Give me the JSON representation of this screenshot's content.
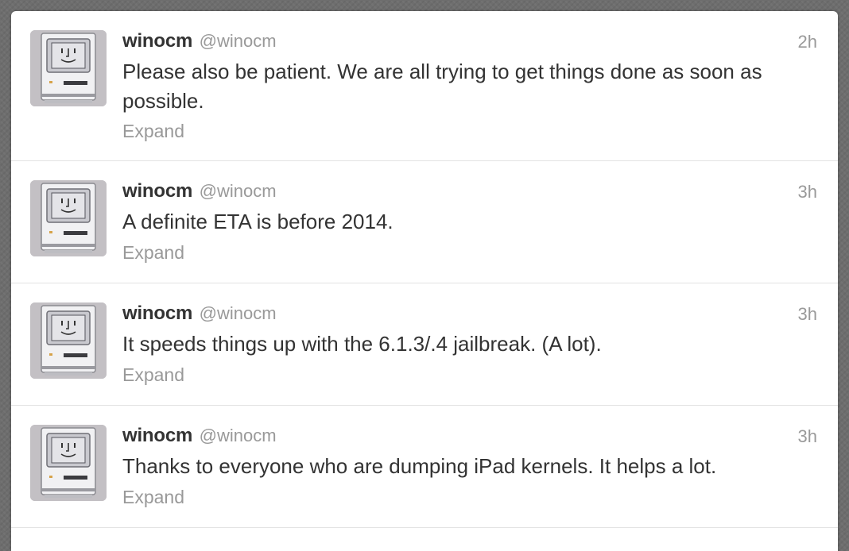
{
  "tweets": [
    {
      "fullname": "winocm",
      "username": "@winocm",
      "time": "2h",
      "text": "Please also be patient. We are all trying to get things done as soon as possible.",
      "expand_label": "Expand"
    },
    {
      "fullname": "winocm",
      "username": "@winocm",
      "time": "3h",
      "text": "A definite ETA is before 2014.",
      "expand_label": "Expand"
    },
    {
      "fullname": "winocm",
      "username": "@winocm",
      "time": "3h",
      "text": "It speeds things up with the 6.1.3/.4 jailbreak. (A lot).",
      "expand_label": "Expand"
    },
    {
      "fullname": "winocm",
      "username": "@winocm",
      "time": "3h",
      "text": "Thanks to everyone who are dumping iPad kernels. It helps a lot.",
      "expand_label": "Expand"
    }
  ],
  "avatar_icon": "happy-mac-icon",
  "colors": {
    "background": "#6e6e6e",
    "card": "#ffffff",
    "name": "#333333",
    "meta": "#999999",
    "divider": "#e3e3e3"
  }
}
